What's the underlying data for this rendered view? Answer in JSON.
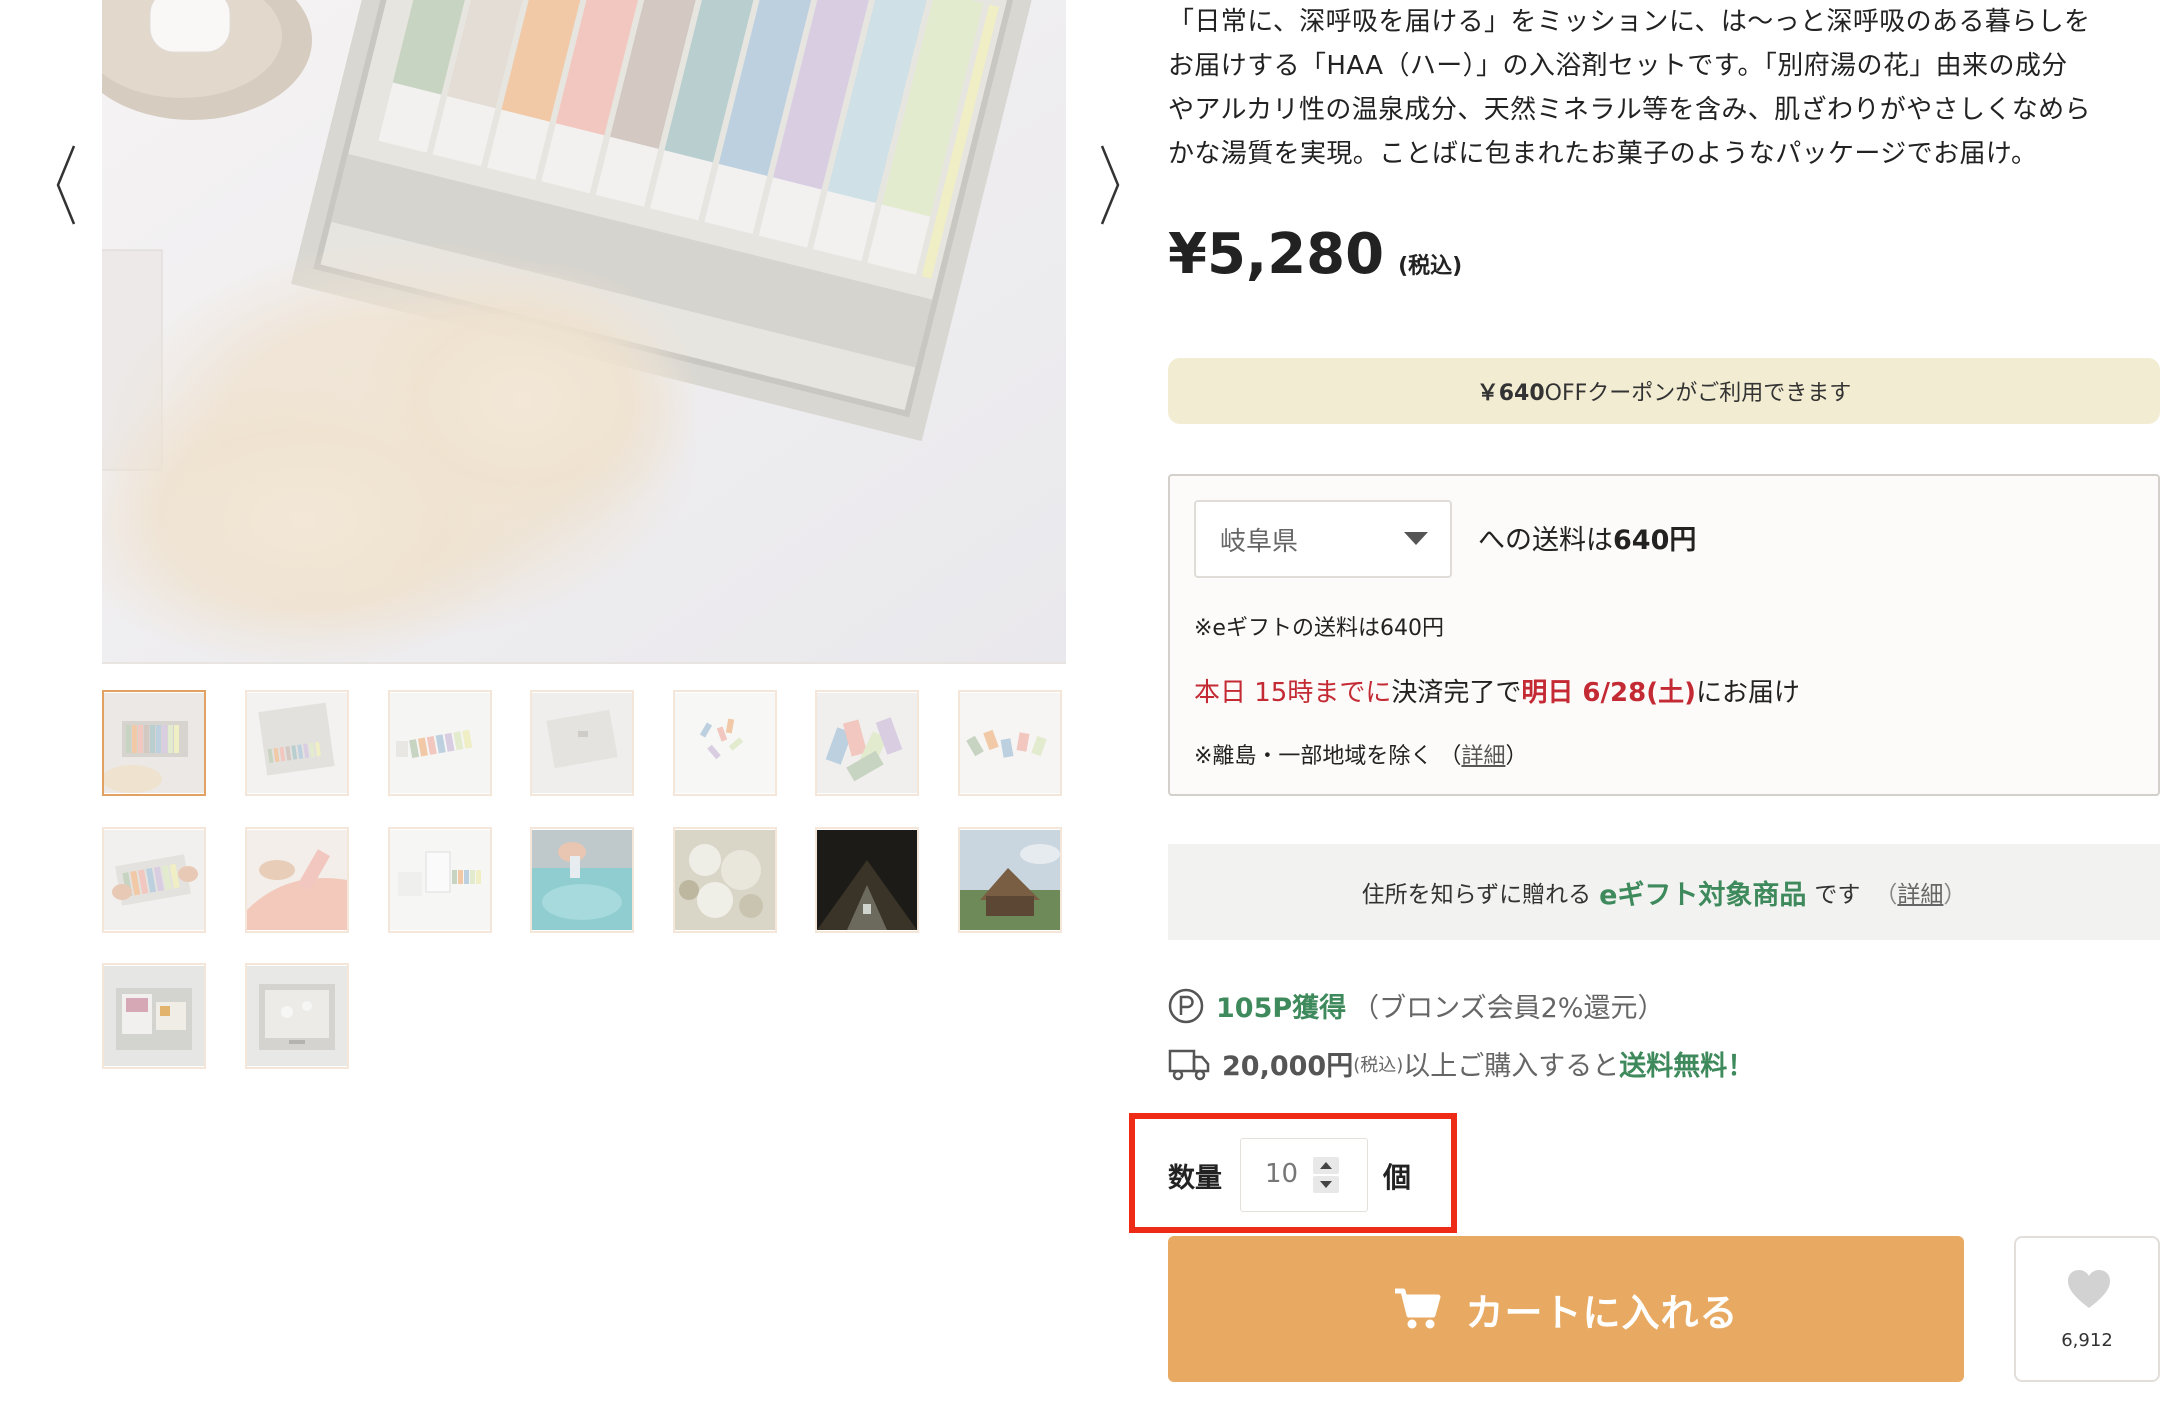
{
  "gallery": {
    "main_image_alt": "HAA入浴剤セット",
    "thumbnail_count": 16,
    "active_index": 0
  },
  "product": {
    "description_lines": [
      "「日常に、深呼吸を届ける」をミッションに、は〜っと深呼吸のある暮らしを",
      "お届けする「HAA（ハー）」の入浴剤セットです。「別府湯の花」由来の成分",
      "やアルカリ性の温泉成分、天然ミネラル等を含み、肌ざわりがやさしくなめら",
      "かな湯質を実現。ことばに包まれたお菓子のようなパッケージでお届け。"
    ],
    "price": "¥5,280",
    "price_tax": "(税込)"
  },
  "coupon": {
    "amount": "￥640",
    "text": " OFFクーポンがご利用できます"
  },
  "shipping": {
    "prefecture": "岐阜県",
    "to_text": "への送料は",
    "fee": "640円",
    "egift_note": "※eギフトの送料は640円",
    "deadline": "本日 15時までに",
    "payment_text": "決済完了で",
    "delivery_date": "明日 6/28(土)",
    "delivery_suffix": "にお届け",
    "remote_note": "※離島・一部地域を除く （",
    "detail_link": "詳細",
    "close_paren": "）"
  },
  "egift": {
    "prefix": "住所を知らずに贈れる",
    "highlight": "eギフト対象商品",
    "suffix": "です",
    "detail_open": "（",
    "detail_link": "詳細",
    "detail_close": "）"
  },
  "points": {
    "earned": "105P獲得",
    "note": "（ブロンズ会員2%還元）"
  },
  "free_shipping": {
    "amount": "20,000円",
    "tax": "(税込)",
    "text": "以上ご購入すると",
    "highlight": "送料無料！"
  },
  "quantity": {
    "label": "数量",
    "value": "10",
    "unit": "個"
  },
  "cart": {
    "label": "カートに入れる"
  },
  "favorite": {
    "count": "6,912"
  },
  "colors": {
    "accent_orange": "#e8aa62",
    "coupon_bg": "#f2ecd2",
    "green": "#3f8a5c",
    "red": "#c42a34",
    "highlight_frame": "#ee2b17"
  }
}
